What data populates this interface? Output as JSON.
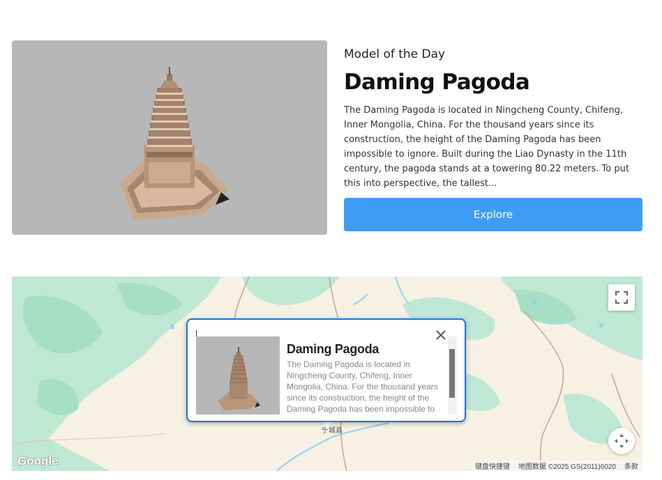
{
  "hero": {
    "eyebrow": "Model of the Day",
    "title": "Daming Pagoda",
    "description": "The Daming Pagoda is located in Ningcheng County, Chifeng, Inner Mongolia, China. For the thousand years since its construction, the height of the Daming Pagoda has been impossible to ignore. Built during the Liao Dynasty in the 11th century, the pagoda stands at a towering 80.22 meters. To put this into perspective, the tallest...",
    "explore_label": "Explore",
    "accent": "#3d9df5"
  },
  "map": {
    "town_label": "宁城县",
    "logo_text": "Google",
    "attribution": {
      "shortcuts": "键盘快捷键",
      "map_data": "地图数据 ©2025 GS(2011)6020",
      "terms": "条款"
    },
    "info_window": {
      "title": "Daming Pagoda",
      "description": "The Daming Pagoda is located in Ningcheng County, Chifeng, Inner Mongolia, China. For the thousand years since its construction, the height of the Daming Pagoda has been impossible to ignore. Bu...",
      "border_color": "#1a73e8"
    },
    "icons": {
      "fullscreen": "fullscreen-icon",
      "camera": "camera-control-icon",
      "close": "close-icon"
    }
  }
}
